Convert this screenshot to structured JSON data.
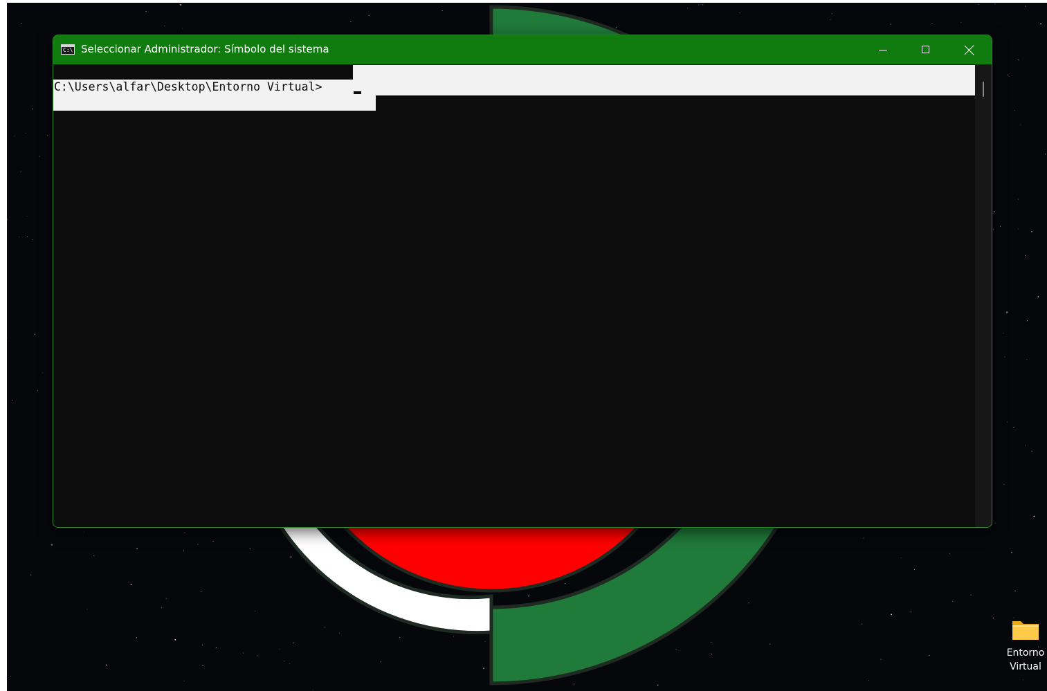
{
  "window": {
    "title": "Seleccionar Administrador: Símbolo del sistema",
    "icon_glyph": "C:\\",
    "icon": "command-prompt-icon",
    "accent_color": "#107c10",
    "buttons": {
      "minimize": "minimize-icon",
      "maximize": "maximize-icon",
      "close": "close-icon"
    }
  },
  "console": {
    "prompt": "C:\\Users\\alfar\\Desktop\\Entorno Virtual>",
    "background_color": "#0c0c0c",
    "selection_color": "#f2f2f2",
    "mode": "selection"
  },
  "desktop": {
    "background": "starfield",
    "icons": [
      {
        "label": "Entorno Virtual",
        "icon": "folder-icon"
      }
    ]
  }
}
